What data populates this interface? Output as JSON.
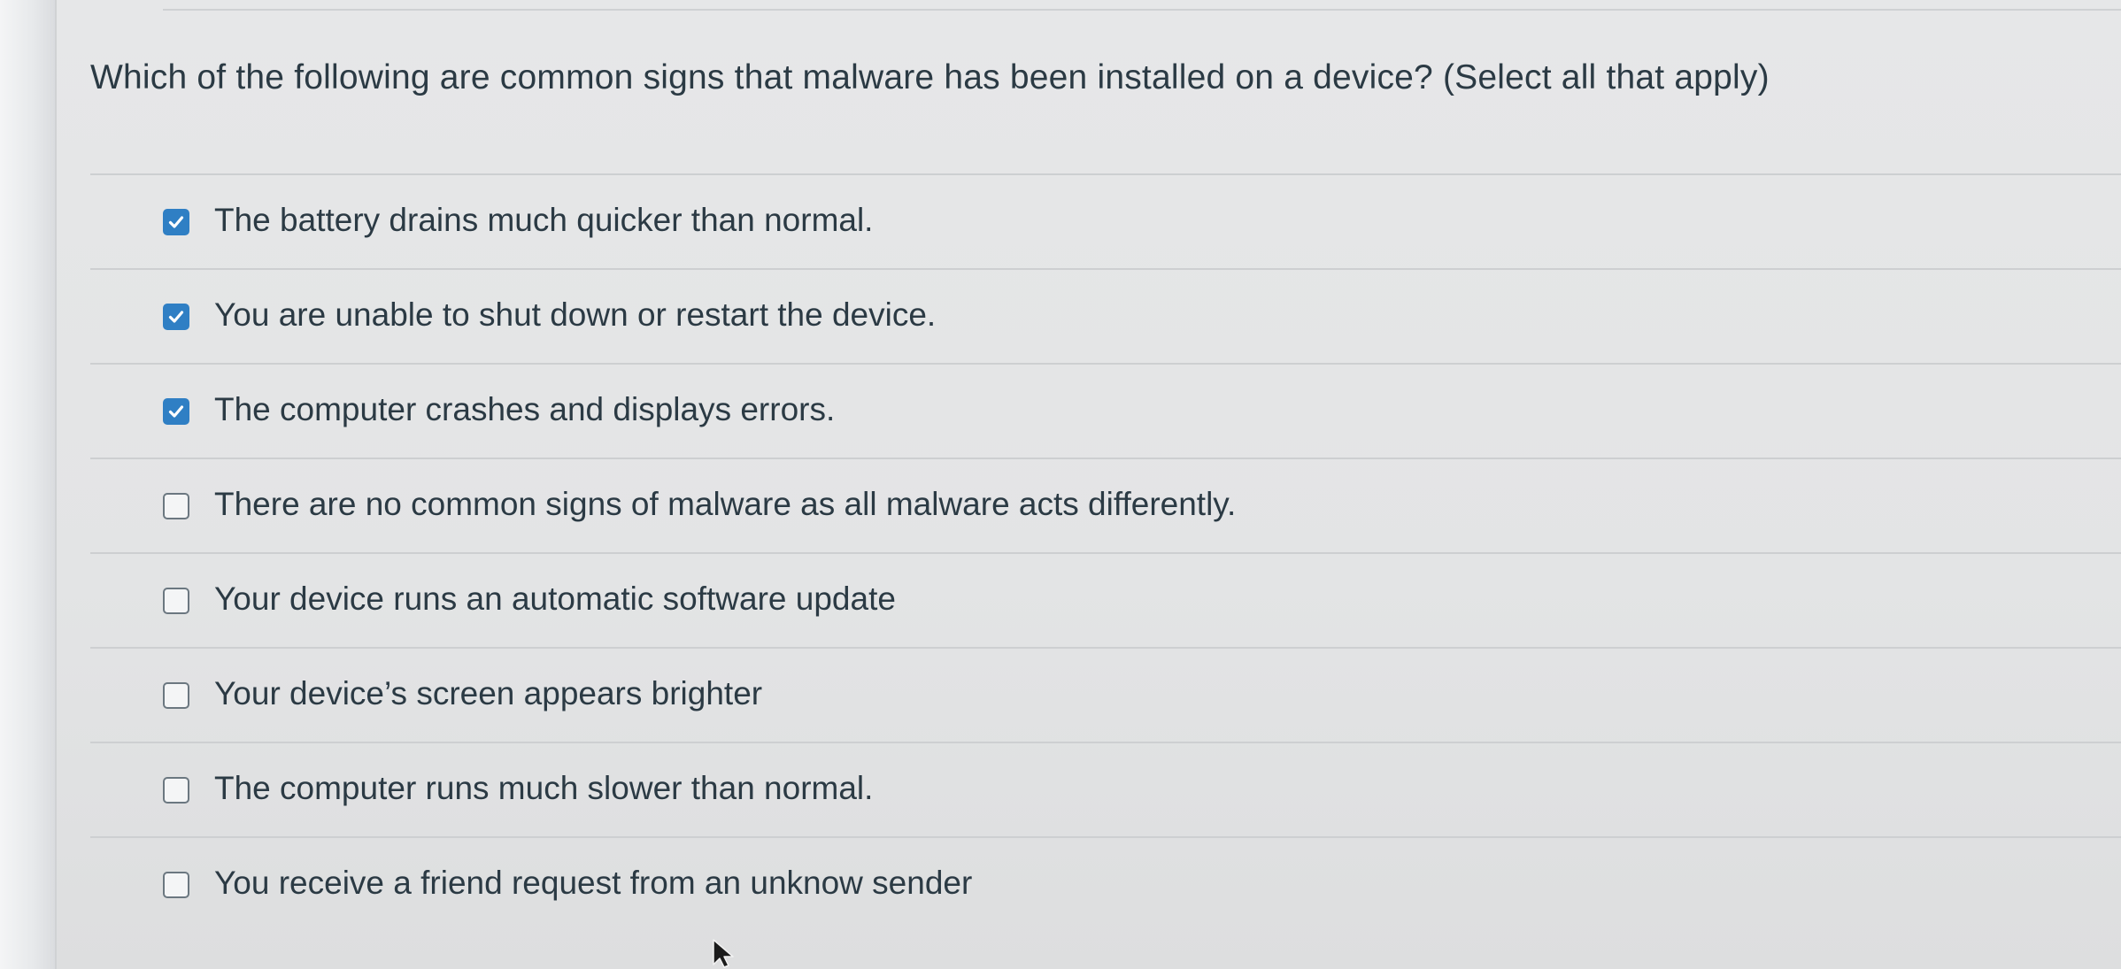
{
  "question": {
    "prompt": "Which of the following are common signs that malware has been installed on a device? (Select all that apply)"
  },
  "answers": [
    {
      "label": "The battery drains much quicker than normal.",
      "checked": true
    },
    {
      "label": "You are unable to shut down or restart the device.",
      "checked": true
    },
    {
      "label": "The computer crashes and displays errors.",
      "checked": true
    },
    {
      "label": "There are no common signs of malware as all malware acts differently.",
      "checked": false
    },
    {
      "label": "Your device runs an automatic software update",
      "checked": false
    },
    {
      "label": "Your device’s screen appears brighter",
      "checked": false
    },
    {
      "label": "The computer runs much slower than normal.",
      "checked": false
    },
    {
      "label": "You receive a friend request from an unknow sender",
      "checked": false
    }
  ],
  "colors": {
    "checkbox_checked": "#2f7fc4",
    "text": "#2b3a44",
    "checkbox_border": "#6b7780"
  },
  "icons": {
    "checked": "checkmark-icon",
    "cursor": "mouse-pointer-icon"
  }
}
